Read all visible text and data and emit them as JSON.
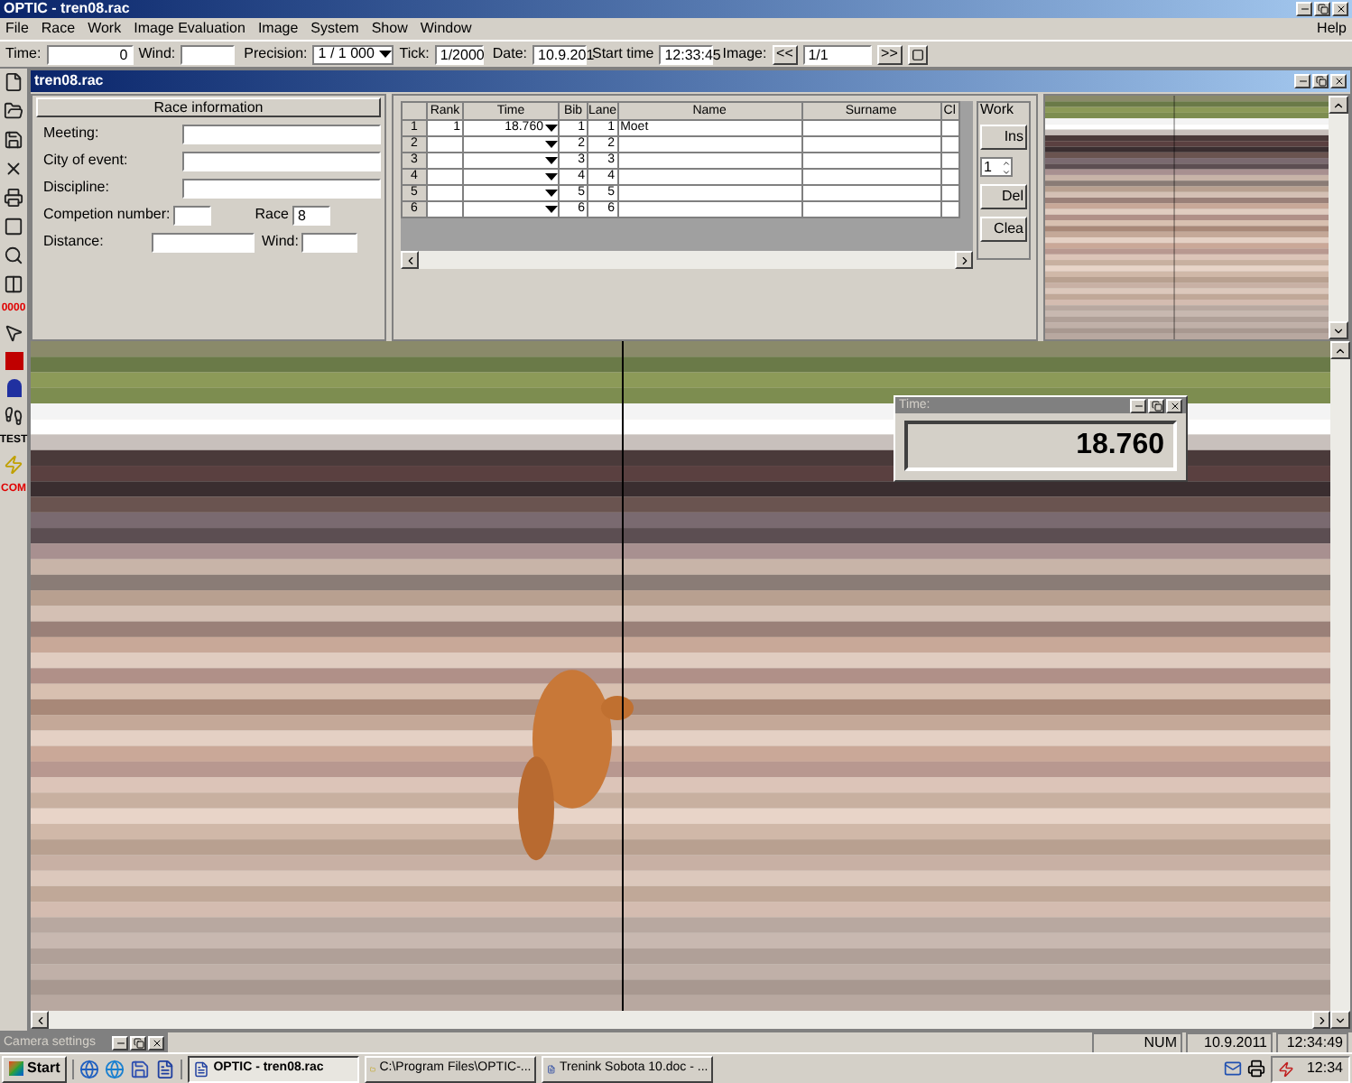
{
  "window": {
    "title": "OPTIC - tren08.rac"
  },
  "menu": [
    "File",
    "Race",
    "Work",
    "Image Evaluation",
    "Image",
    "System",
    "Show",
    "Window"
  ],
  "menu_right": "Help",
  "toolbar": {
    "time_label": "Time:",
    "time_value": "0",
    "wind_label": "Wind:",
    "precision_label": "Precision:",
    "precision_value": "1 / 1 000",
    "tick_label": "Tick:",
    "tick_value": "1/2000",
    "date_label": "Date:",
    "date_value": "10.9.201",
    "start_label": "Start time",
    "start_value": "12:33:45",
    "image_label": "Image:",
    "prev": "<<",
    "image_value": "1/1",
    "next": ">>"
  },
  "side_tools": [
    {
      "kind": "icon"
    },
    {
      "kind": "icon"
    },
    {
      "kind": "icon"
    },
    {
      "kind": "icon"
    },
    {
      "kind": "icon"
    },
    {
      "kind": "icon"
    },
    {
      "kind": "icon"
    },
    {
      "kind": "icon"
    },
    {
      "kind": "text",
      "text": "0000"
    },
    {
      "kind": "icon"
    },
    {
      "kind": "icon"
    },
    {
      "kind": "icon"
    },
    {
      "kind": "icon"
    },
    {
      "kind": "text",
      "text": "TEST"
    },
    {
      "kind": "icon"
    },
    {
      "kind": "text",
      "text": "COM"
    }
  ],
  "child": {
    "title": "tren08.rac"
  },
  "race_info": {
    "header": "Race information",
    "fields": [
      {
        "label": "Meeting:"
      },
      {
        "label": "City of event:"
      },
      {
        "label": "Discipline:"
      }
    ],
    "competition_label": "Competion number:",
    "race_label": "Race",
    "race_value": "8",
    "distance_label": "Distance:",
    "wind_label": "Wind:"
  },
  "table": {
    "columns": [
      "Rank",
      "Time",
      "Bib",
      "Lane",
      "Name",
      "Surname",
      "Cl"
    ],
    "rows": [
      {
        "num": "1",
        "rank": "1",
        "time": "18.760",
        "bib": "1",
        "lane": "1",
        "name": "Moet",
        "surname": ""
      },
      {
        "num": "2",
        "rank": "",
        "time": "",
        "bib": "2",
        "lane": "2",
        "name": "",
        "surname": ""
      },
      {
        "num": "3",
        "rank": "",
        "time": "",
        "bib": "3",
        "lane": "3",
        "name": "",
        "surname": ""
      },
      {
        "num": "4",
        "rank": "",
        "time": "",
        "bib": "4",
        "lane": "4",
        "name": "",
        "surname": ""
      },
      {
        "num": "5",
        "rank": "",
        "time": "",
        "bib": "5",
        "lane": "5",
        "name": "",
        "surname": ""
      },
      {
        "num": "6",
        "rank": "",
        "time": "",
        "bib": "6",
        "lane": "6",
        "name": "",
        "surname": ""
      }
    ]
  },
  "work": {
    "title": "Work",
    "insert": "Ins",
    "spin": "1",
    "delete": "Del",
    "clear": "Clea"
  },
  "time_window": {
    "title": "Time:",
    "value": "18.760"
  },
  "camera_settings": {
    "title": "Camera settings"
  },
  "status_bar": {
    "num": "NUM",
    "date": "10.9.2011",
    "time": "12:34:49"
  },
  "taskbar": {
    "start": "Start",
    "tasks": [
      {
        "label": "OPTIC - tren08.rac",
        "selected": true
      },
      {
        "label": "C:\\Program Files\\OPTIC-...",
        "selected": false
      },
      {
        "label": "Trenink Sobota 10.doc - ...",
        "selected": false
      }
    ],
    "clock": "12:34"
  }
}
